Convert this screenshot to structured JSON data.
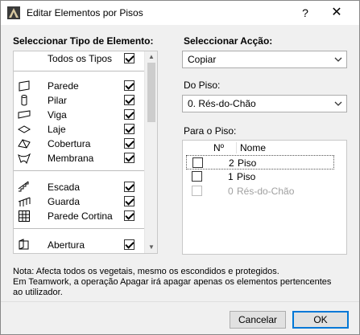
{
  "window": {
    "title": "Editar Elementos por Pisos",
    "help_label": "?",
    "close_label": "✕"
  },
  "types": {
    "heading": "Seleccionar Tipo de Elemento:",
    "all_label": "Todos os Tipos",
    "all_checked": true,
    "groups": [
      [
        {
          "label": "Parede",
          "icon": "wall-icon",
          "checked": true
        },
        {
          "label": "Pilar",
          "icon": "column-icon",
          "checked": true
        },
        {
          "label": "Viga",
          "icon": "beam-icon",
          "checked": true
        },
        {
          "label": "Laje",
          "icon": "slab-icon",
          "checked": true
        },
        {
          "label": "Cobertura",
          "icon": "roof-icon",
          "checked": true
        },
        {
          "label": "Membrana",
          "icon": "shell-icon",
          "checked": true
        }
      ],
      [
        {
          "label": "Escada",
          "icon": "stair-icon",
          "checked": true
        },
        {
          "label": "Guarda",
          "icon": "railing-icon",
          "checked": true
        },
        {
          "label": "Parede Cortina",
          "icon": "curtain-wall-icon",
          "checked": true
        }
      ],
      [
        {
          "label": "Abertura",
          "icon": "opening-icon",
          "checked": true
        }
      ]
    ]
  },
  "action": {
    "heading": "Seleccionar Acção:",
    "selected": "Copiar"
  },
  "from_floor": {
    "label": "Do Piso:",
    "selected": "0. Rés-do-Chão"
  },
  "to_floor": {
    "label": "Para o Piso:",
    "col_num": "Nº",
    "col_name": "Nome",
    "rows": [
      {
        "num": "2",
        "name": "Piso",
        "checked": false,
        "disabled": false,
        "selected": true
      },
      {
        "num": "1",
        "name": "Piso",
        "checked": false,
        "disabled": false,
        "selected": false
      },
      {
        "num": "0",
        "name": "Rés-do-Chão",
        "checked": false,
        "disabled": true,
        "selected": false
      }
    ]
  },
  "note": {
    "line1": "Nota: Afecta todos os vegetais, mesmo os escondidos e protegidos.",
    "line2": "Em Teamwork, a operação Apagar irá apagar apenas os elementos pertencentes",
    "line3": "ao utilizador."
  },
  "buttons": {
    "cancel": "Cancelar",
    "ok": "OK"
  },
  "colors": {
    "accent": "#0078d7",
    "window_bg": "#f0f0f0"
  }
}
